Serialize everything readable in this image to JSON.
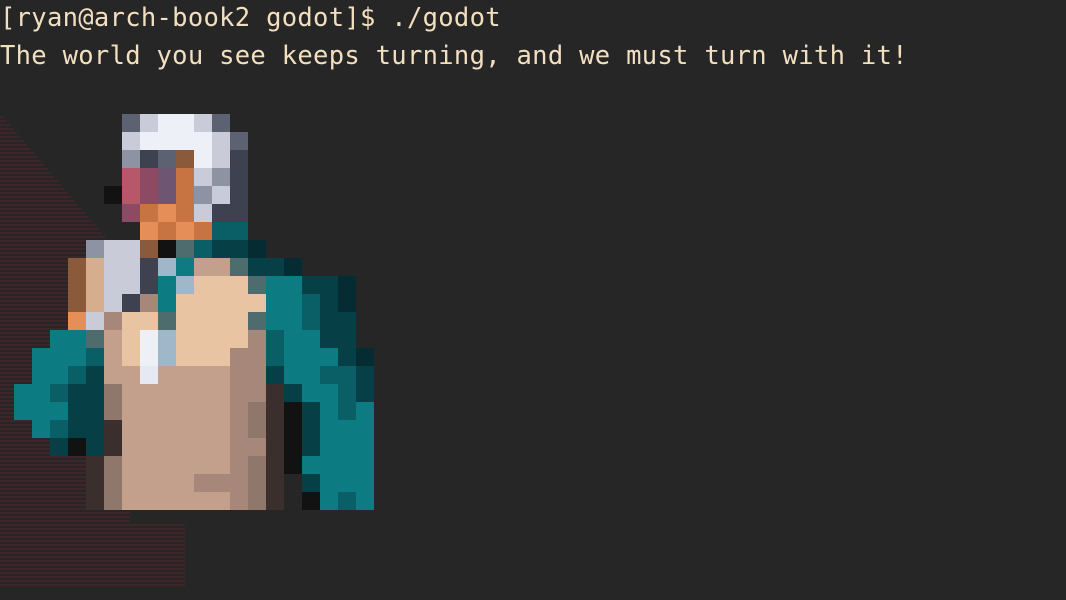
{
  "terminal": {
    "prompt": "[ryan@arch-book2 godot]$ ./godot",
    "output": "The world you see keeps turning, and we must turn with it!"
  },
  "colors": {
    "background": "#262626",
    "text": "#f2dfc0",
    "stripe": "#3d2629",
    "teal": "#0d7b82",
    "skin": "#e2bea0",
    "hair": "#d8dbe6"
  }
}
